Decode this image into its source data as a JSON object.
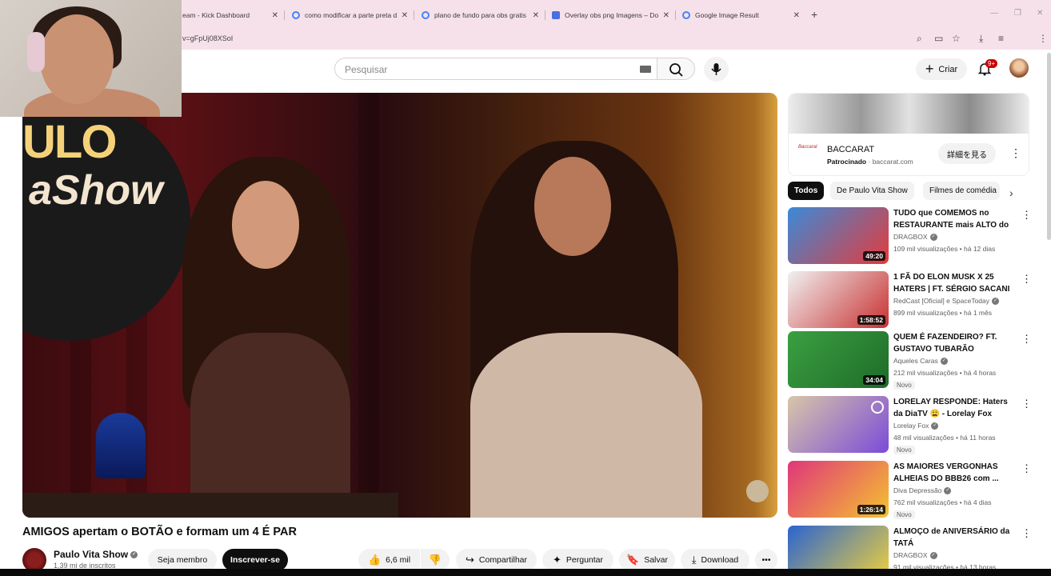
{
  "browser": {
    "tabs": [
      {
        "title": "eam - Kick Dashboard",
        "icon": "kick-icon"
      },
      {
        "title": "como modificar a parte preta d",
        "icon": "google-icon"
      },
      {
        "title": "plano de fundo para obs gratis",
        "icon": "google-icon"
      },
      {
        "title": "Overlay obs png Imagens – Do",
        "icon": "docs-icon"
      },
      {
        "title": "Google Image Result",
        "icon": "google-icon"
      }
    ],
    "url": "v=gFpUj08XSoI"
  },
  "header": {
    "search_placeholder": "Pesquisar",
    "create_label": "Criar",
    "notifications_count": "9+"
  },
  "player": {
    "show_logo_line1": "ULO",
    "show_logo_line2": "aShow"
  },
  "video": {
    "title": "AMIGOS apertam o BOTÃO e formam um 4 É PAR",
    "channel_name": "Paulo Vita Show",
    "subscribers": "1,39 mi de inscritos",
    "join_label": "Seja membro",
    "subscribe_label": "Inscrever-se",
    "likes": "6,6 mil",
    "share_label": "Compartilhar",
    "ask_label": "Perguntar",
    "save_label": "Salvar",
    "download_label": "Download"
  },
  "ad": {
    "brand": "BACCARAT",
    "sponsored": "Patrocinado",
    "domain": "baccarat.com",
    "cta": "詳細を見る"
  },
  "chips": [
    "Todos",
    "De Paulo Vita Show",
    "Filmes de comédia"
  ],
  "recommendations": [
    {
      "title": "TUDO que COMEMOS no RESTAURANTE mais ALTO do ...",
      "channel": "DRAGBOX",
      "verified": true,
      "meta": "109 mil visualizações • há 12 dias",
      "duration": "49:20",
      "badge": "",
      "thumb_colors": [
        "#3a8ad8",
        "#e43b3b"
      ]
    },
    {
      "title": "1 FÃ DO ELON MUSK X 25 HATERS | FT. SÉRGIO SACANI",
      "channel": "RedCast [Oficial] e SpaceToday",
      "verified": true,
      "meta": "899 mil visualizações • há 1 mês",
      "duration": "1:58:52",
      "badge": "",
      "thumb_colors": [
        "#f1f1f1",
        "#c83030"
      ]
    },
    {
      "title": "QUEM É FAZENDEIRO? FT. GUSTAVO TUBARÃO",
      "channel": "Aqueles Caras",
      "verified": true,
      "meta": "212 mil visualizações • há 4 horas",
      "duration": "34:04",
      "badge": "Novo",
      "thumb_colors": [
        "#3aa040",
        "#1f6b2a"
      ]
    },
    {
      "title": "LORELAY RESPONDE: Haters da DiaTV 😩 - Lorelay Fox",
      "channel": "Lorelay Fox",
      "verified": true,
      "meta": "48 mil visualizações • há 11 horas",
      "duration": "",
      "badge": "Novo",
      "thumb_colors": [
        "#d9c6a8",
        "#7b4bd8"
      ]
    },
    {
      "title": "AS MAIORES VERGONHAS ALHEIAS DO BBB26 com ...",
      "channel": "Diva Depressão",
      "verified": true,
      "meta": "762 mil visualizações • há 4 dias",
      "duration": "1:26:14",
      "badge": "Novo",
      "thumb_colors": [
        "#e0367a",
        "#f4c230"
      ]
    },
    {
      "title": "ALMOÇO de ANIVERSÁRIO da TATÁ",
      "channel": "DRAGBOX",
      "verified": true,
      "meta": "91 mil visualizações • há 13 horas",
      "duration": "",
      "badge": "",
      "thumb_colors": [
        "#2a64d0",
        "#f2d23a"
      ]
    }
  ],
  "colors": {
    "tab_strip": "#f6e1ea",
    "subscribe_bg": "#0f0f0f",
    "badge_red": "#cc0000"
  }
}
